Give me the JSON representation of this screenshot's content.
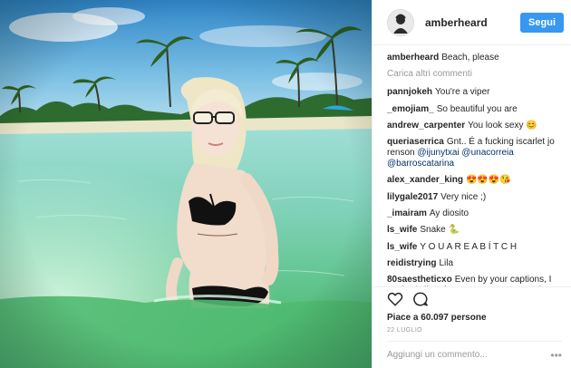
{
  "post": {
    "username": "amberheard",
    "follow_label": "Segui",
    "caption": {
      "user": "amberheard",
      "text": "Beach, please"
    },
    "load_more": "Carica altri commenti",
    "comments": [
      {
        "user": "pannjokeh",
        "text": "You're a viper"
      },
      {
        "user": "_emojiam_",
        "text": "So beautiful you are"
      },
      {
        "user": "andrew_carpenter",
        "text": "You look sexy 😊"
      },
      {
        "user": "queriaserrica",
        "text": "Gnt.. É a fucking iscarlet jo renson ",
        "mentions": "@ijunytxai @unacorreia @barroscatarina"
      },
      {
        "user": "alex_xander_king",
        "text": "😍😍😍😘"
      },
      {
        "user": "lilygale2017",
        "text": "Very nice ;)"
      },
      {
        "user": "_imairam",
        "text": "Ay diosito"
      },
      {
        "user": "ls_wife",
        "text": "Snake 🐍"
      },
      {
        "user": "ls_wife",
        "text": "Y O U A R E A B Í T C H"
      },
      {
        "user": "reidistrying",
        "text": "Lila"
      },
      {
        "user": "80saestheticxo",
        "text": "Even by your captions, I get bad vibes from you. You are a snake"
      }
    ],
    "likes": "Piace a 60.097 persone",
    "date": "22 LUGLIO",
    "add_comment_placeholder": "Aggiungi un commento...",
    "icons": {
      "like": "heart-icon",
      "comment": "comment-icon",
      "more": "more-options-icon"
    }
  }
}
